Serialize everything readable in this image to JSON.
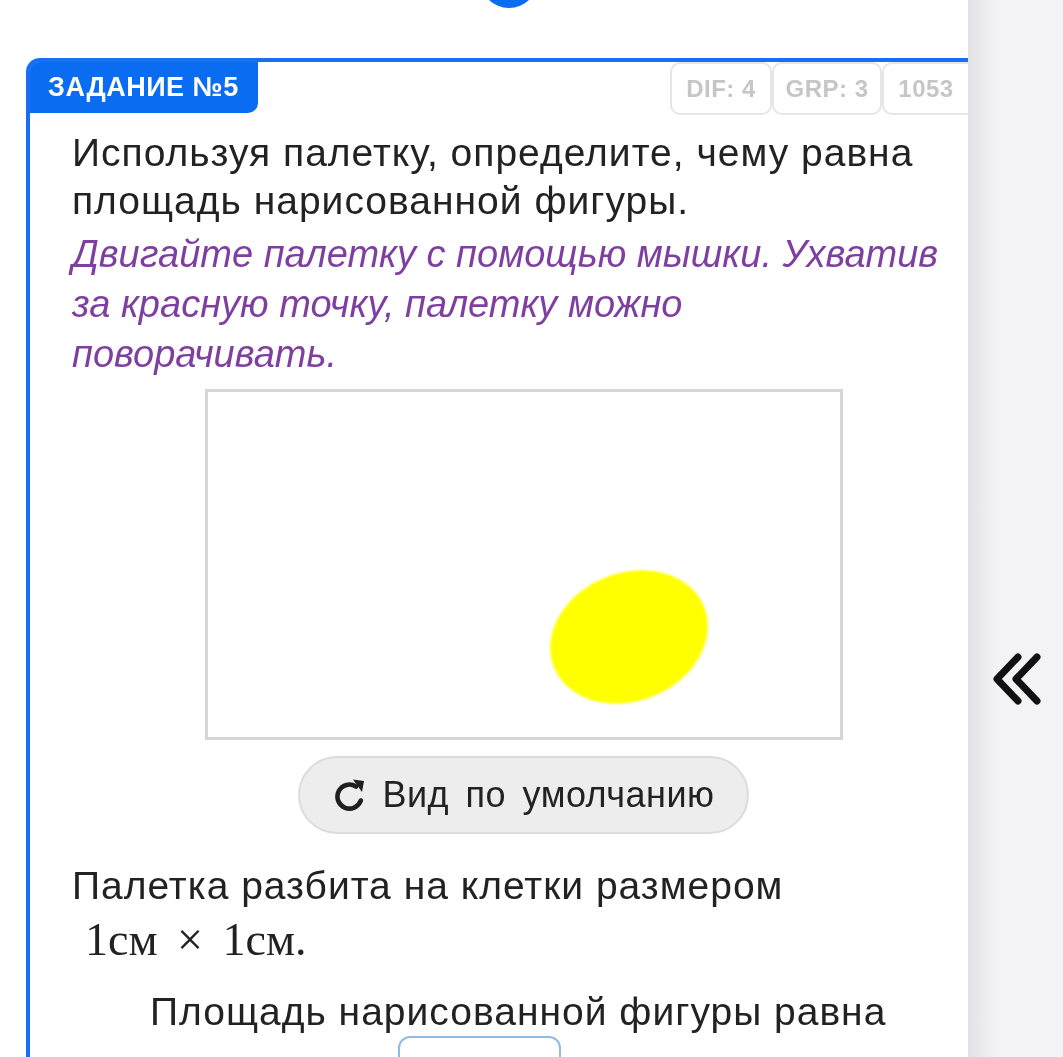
{
  "task": {
    "label": "ЗАДАНИЕ №5",
    "tags": [
      "DIF: 4",
      "GRP: 3",
      "1053"
    ],
    "question": "Используя палетку, определите, чему равна площадь нарисованной фигуры.",
    "hint": "Двигайте палетку с помощью мышки. Ухватив за красную точку, палетку можно поворачивать.",
    "reset_button": "Вид по умолчанию",
    "grid_note": "Палетка разбита на клетки размером",
    "grid_size": "1см × 1см.",
    "answer_prompt": "Площадь нарисованной фигуры равна"
  }
}
